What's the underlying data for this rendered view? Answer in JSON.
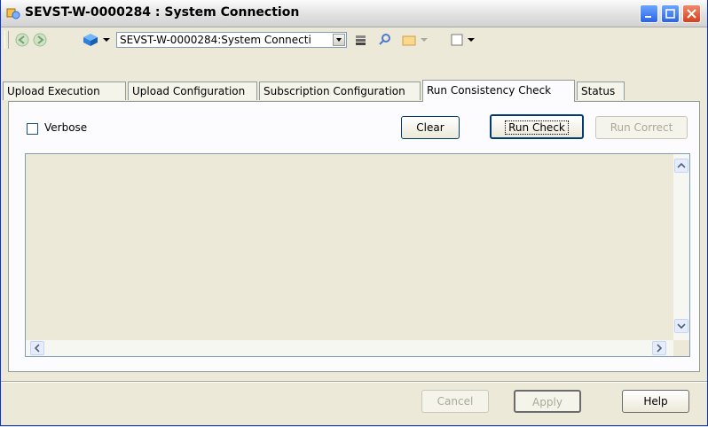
{
  "window": {
    "title": "SEVST-W-0000284 : System Connection",
    "icon": "system-connection-icon"
  },
  "toolbar": {
    "connection_select_value": "SEVST-W-0000284:System Connecti",
    "icons": [
      "back-arrow-icon",
      "forward-arrow-icon",
      "cube-icon",
      "stack-icon",
      "pin-icon",
      "folder-icon",
      "window-icon"
    ]
  },
  "tabs": [
    {
      "label": "Upload Execution"
    },
    {
      "label": "Upload Configuration"
    },
    {
      "label": "Subscription Configuration"
    },
    {
      "label": "Run Consistency Check"
    },
    {
      "label": "Status"
    }
  ],
  "panel": {
    "verbose_label": "Verbose",
    "clear_label": "Clear",
    "run_check_label": "Run Check",
    "run_correct_label": "Run Correct"
  },
  "footer": {
    "cancel_label": "Cancel",
    "apply_label": "Apply",
    "help_label": "Help"
  },
  "colors": {
    "titlebar_accent": "#d4401c",
    "window_bg": "#ece9d8",
    "border_blue": "#7f9db9"
  }
}
